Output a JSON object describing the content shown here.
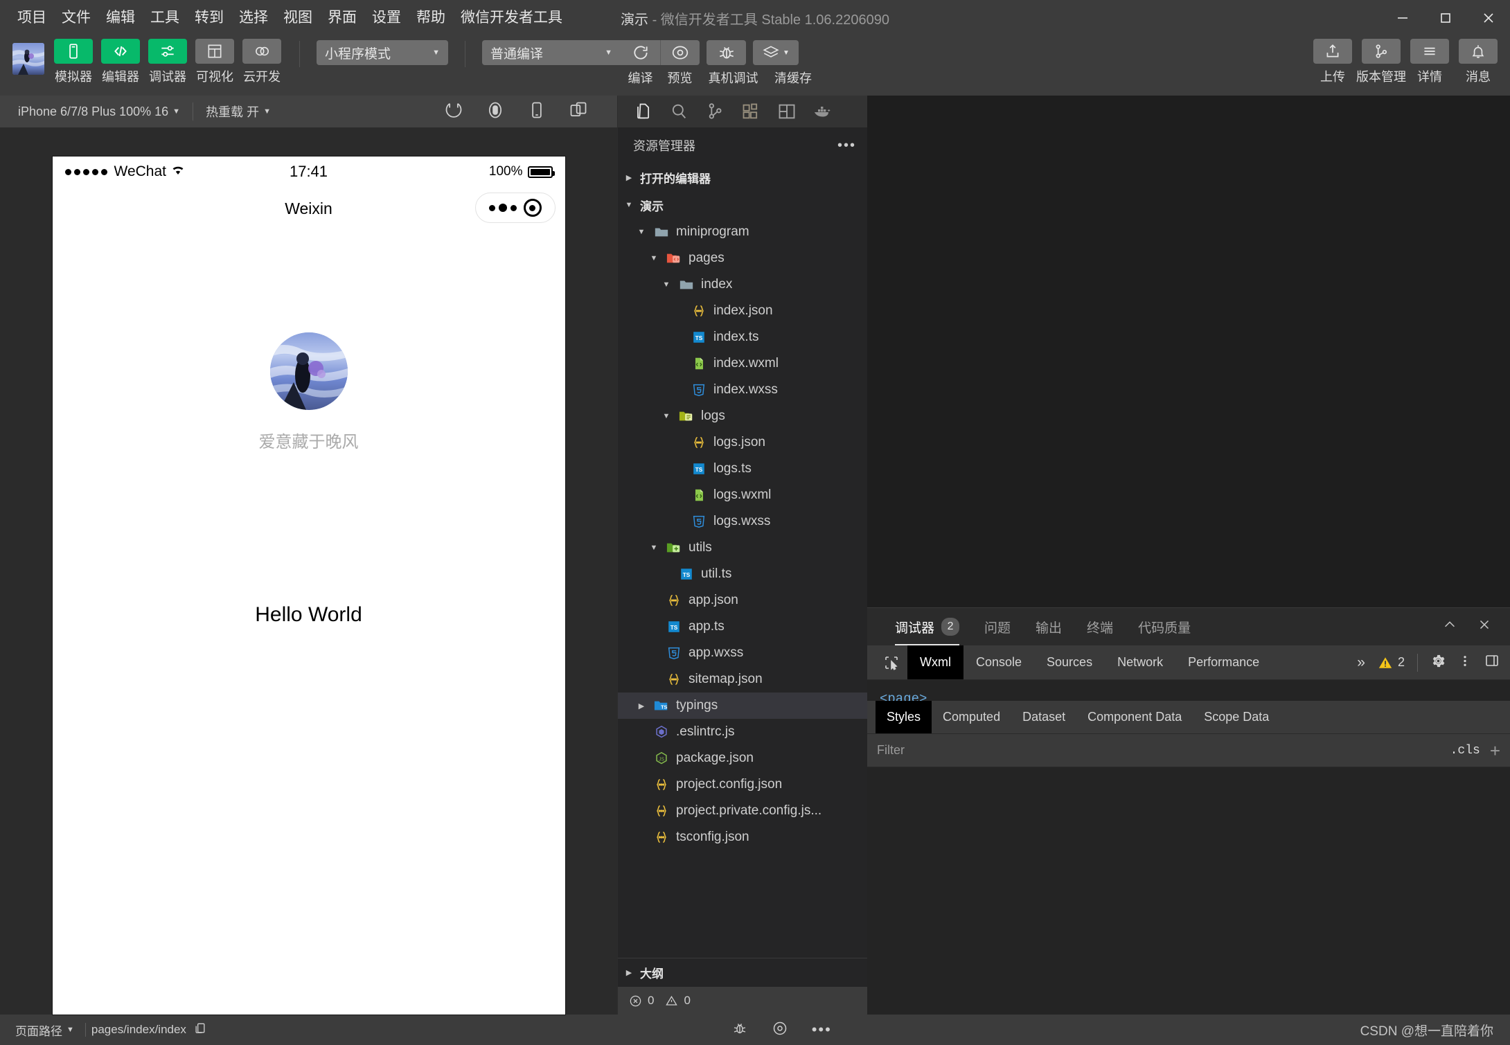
{
  "window": {
    "project_name": "演示",
    "title_suffix": "- 微信开发者工具 Stable 1.06.2206090",
    "minimize": "minimize-icon",
    "maximize": "maximize-icon",
    "close": "close-icon"
  },
  "menubar": {
    "items": [
      "项目",
      "文件",
      "编辑",
      "工具",
      "转到",
      "选择",
      "视图",
      "界面",
      "设置",
      "帮助",
      "微信开发者工具"
    ]
  },
  "toolbar": {
    "buttons": [
      {
        "label": "模拟器",
        "icon": "phone-icon",
        "style": "green"
      },
      {
        "label": "编辑器",
        "icon": "code-icon",
        "style": "green"
      },
      {
        "label": "调试器",
        "icon": "sliders-icon",
        "style": "green"
      },
      {
        "label": "可视化",
        "icon": "layout-icon",
        "style": "grey"
      },
      {
        "label": "云开发",
        "icon": "cloud-icon",
        "style": "grey"
      }
    ],
    "mode_select": "小程序模式",
    "compile_select": "普通编译",
    "actions": [
      {
        "label": "编译",
        "icon": "refresh-icon"
      },
      {
        "label": "预览",
        "icon": "eye-icon"
      },
      {
        "label": "真机调试",
        "icon": "bug-icon"
      },
      {
        "label": "清缓存",
        "icon": "layers-icon"
      }
    ],
    "right_buttons": [
      {
        "label": "上传",
        "icon": "upload-icon"
      },
      {
        "label": "版本管理",
        "icon": "branch-icon"
      },
      {
        "label": "详情",
        "icon": "menu-icon"
      },
      {
        "label": "消息",
        "icon": "bell-icon"
      }
    ]
  },
  "simulator": {
    "device_select": "iPhone 6/7/8 Plus 100% 16",
    "hotreload_select": "热重载 开",
    "icons": [
      "rotate-icon",
      "record-icon",
      "device-icon",
      "multiscreen-icon"
    ],
    "phone": {
      "carrier": "WeChat",
      "time": "17:41",
      "battery_percent": "100%",
      "nav_title": "Weixin",
      "nickname": "爱意藏于晚风",
      "body_text": "Hello World"
    }
  },
  "statusbar": {
    "page_path_label": "页面路径",
    "page_path_value": "pages/index/index",
    "copy_icon": "copy-icon",
    "right_icons": [
      "bug-icon",
      "eye-icon",
      "more-icon"
    ]
  },
  "explorer": {
    "activity_icons": [
      "files-icon",
      "search-icon",
      "source-control-icon",
      "extensions-icon",
      "split-editor-icon",
      "docker-icon"
    ],
    "title": "资源管理器",
    "more_icon": "more-icon",
    "sections": [
      {
        "label": "打开的编辑器",
        "expanded": false
      },
      {
        "label": "演示",
        "expanded": true
      }
    ],
    "tree": [
      {
        "label": "miniprogram",
        "indent": 1,
        "type": "folder",
        "arrow": "down",
        "icon": "folder-icon"
      },
      {
        "label": "pages",
        "indent": 2,
        "type": "folder",
        "arrow": "down",
        "icon": "folder-pages-icon"
      },
      {
        "label": "index",
        "indent": 3,
        "type": "folder",
        "arrow": "down",
        "icon": "folder-icon"
      },
      {
        "label": "index.json",
        "indent": 4,
        "type": "file",
        "arrow": "none",
        "icon": "json-icon"
      },
      {
        "label": "index.ts",
        "indent": 4,
        "type": "file",
        "arrow": "none",
        "icon": "ts-icon"
      },
      {
        "label": "index.wxml",
        "indent": 4,
        "type": "file",
        "arrow": "none",
        "icon": "wxml-icon"
      },
      {
        "label": "index.wxss",
        "indent": 4,
        "type": "file",
        "arrow": "none",
        "icon": "css-icon"
      },
      {
        "label": "logs",
        "indent": 3,
        "type": "folder",
        "arrow": "down",
        "icon": "folder-logs-icon"
      },
      {
        "label": "logs.json",
        "indent": 4,
        "type": "file",
        "arrow": "none",
        "icon": "json-icon"
      },
      {
        "label": "logs.ts",
        "indent": 4,
        "type": "file",
        "arrow": "none",
        "icon": "ts-icon"
      },
      {
        "label": "logs.wxml",
        "indent": 4,
        "type": "file",
        "arrow": "none",
        "icon": "wxml-icon"
      },
      {
        "label": "logs.wxss",
        "indent": 4,
        "type": "file",
        "arrow": "none",
        "icon": "css-icon"
      },
      {
        "label": "utils",
        "indent": 2,
        "type": "folder",
        "arrow": "down",
        "icon": "folder-utils-icon"
      },
      {
        "label": "util.ts",
        "indent": 3,
        "type": "file",
        "arrow": "none",
        "icon": "ts-icon"
      },
      {
        "label": "app.json",
        "indent": 2,
        "type": "file",
        "arrow": "none",
        "icon": "json-icon"
      },
      {
        "label": "app.ts",
        "indent": 2,
        "type": "file",
        "arrow": "none",
        "icon": "ts-icon"
      },
      {
        "label": "app.wxss",
        "indent": 2,
        "type": "file",
        "arrow": "none",
        "icon": "css-icon"
      },
      {
        "label": "sitemap.json",
        "indent": 2,
        "type": "file",
        "arrow": "none",
        "icon": "json-icon"
      },
      {
        "label": "typings",
        "indent": 1,
        "type": "folder",
        "arrow": "right",
        "icon": "folder-ts-icon",
        "selected": true
      },
      {
        "label": ".eslintrc.js",
        "indent": 1,
        "type": "file",
        "arrow": "none",
        "icon": "eslint-icon"
      },
      {
        "label": "package.json",
        "indent": 1,
        "type": "file",
        "arrow": "none",
        "icon": "npm-icon"
      },
      {
        "label": "project.config.json",
        "indent": 1,
        "type": "file",
        "arrow": "none",
        "icon": "json-icon"
      },
      {
        "label": "project.private.config.js...",
        "indent": 1,
        "type": "file",
        "arrow": "none",
        "icon": "json-icon"
      },
      {
        "label": "tsconfig.json",
        "indent": 1,
        "type": "file",
        "arrow": "none",
        "icon": "json-icon"
      }
    ],
    "outline_label": "大纲",
    "problems": {
      "errors": "0",
      "warnings": "0"
    }
  },
  "devpanel": {
    "tabs": [
      {
        "label": "调试器",
        "badge": "2",
        "active": true
      },
      {
        "label": "问题",
        "badge": "",
        "active": false
      },
      {
        "label": "输出",
        "badge": "",
        "active": false
      },
      {
        "label": "终端",
        "badge": "",
        "active": false
      },
      {
        "label": "代码质量",
        "badge": "",
        "active": false
      }
    ],
    "collapse_icon": "chevron-up-icon",
    "close_icon": "close-icon",
    "devtools_tabs": [
      {
        "label": "Wxml",
        "active": true
      },
      {
        "label": "Console",
        "active": false
      },
      {
        "label": "Sources",
        "active": false
      },
      {
        "label": "Network",
        "active": false
      },
      {
        "label": "Performance",
        "active": false
      }
    ],
    "overflow": "»",
    "warning_count": "2",
    "settings_icon": "gear-icon",
    "kebab_icon": "kebab-icon",
    "dock_icon": "dock-icon",
    "inspect_icon": "inspect-icon",
    "wxml_preview": "<page>",
    "styles_tabs": [
      {
        "label": "Styles",
        "active": true
      },
      {
        "label": "Computed",
        "active": false
      },
      {
        "label": "Dataset",
        "active": false
      },
      {
        "label": "Component Data",
        "active": false
      },
      {
        "label": "Scope Data",
        "active": false
      }
    ],
    "filter_placeholder": "Filter",
    "cls_label": ".cls",
    "plus_label": "+"
  },
  "watermark": "CSDN @想一直陪着你",
  "colors": {
    "accent_green": "#07b96a",
    "titlebar": "#3c3c3c",
    "explorer_bg": "#252526",
    "editor_bg": "#1e1e1e",
    "selected_row": "#37373d"
  }
}
